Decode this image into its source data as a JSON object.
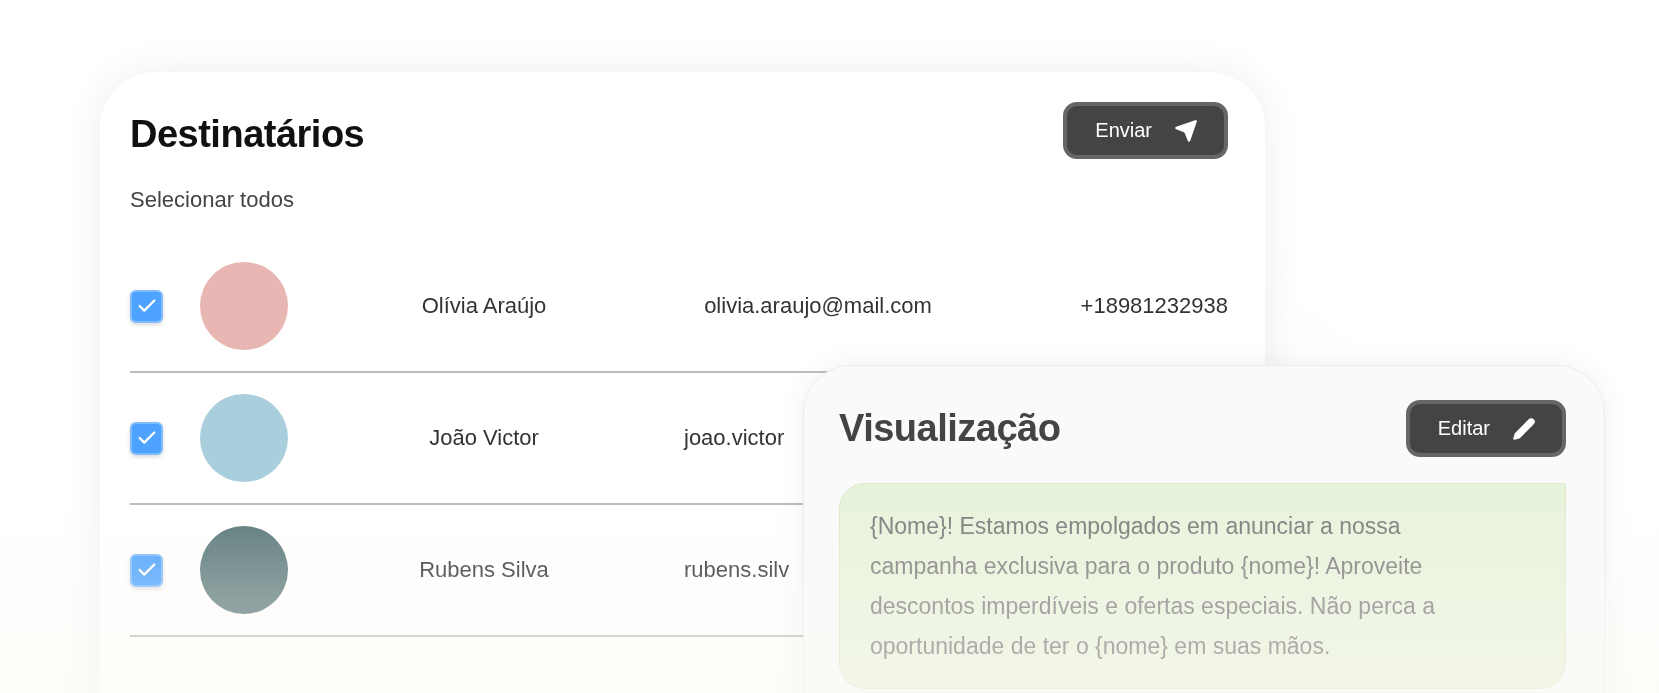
{
  "recipients": {
    "title": "Destinatários",
    "send_button": "Enviar",
    "select_all": "Selecionar todos",
    "rows": [
      {
        "name": "Olívia Araújo",
        "email": "olivia.araujo@mail.com",
        "phone": "+18981232938",
        "checked": true
      },
      {
        "name": "João Victor",
        "email": "joao.victor",
        "checked": true
      },
      {
        "name": "Rubens Silva",
        "email": "rubens.silv",
        "checked": true
      }
    ]
  },
  "preview": {
    "title": "Visualização",
    "edit_button": "Editar",
    "message": "{Nome}! Estamos empolgados em anunciar a nossa campanha exclusiva para o produto {nome}! Aproveite descontos imperdíveis e ofertas especiais. Não perca a oportunidade de ter o {nome} em suas mãos."
  }
}
